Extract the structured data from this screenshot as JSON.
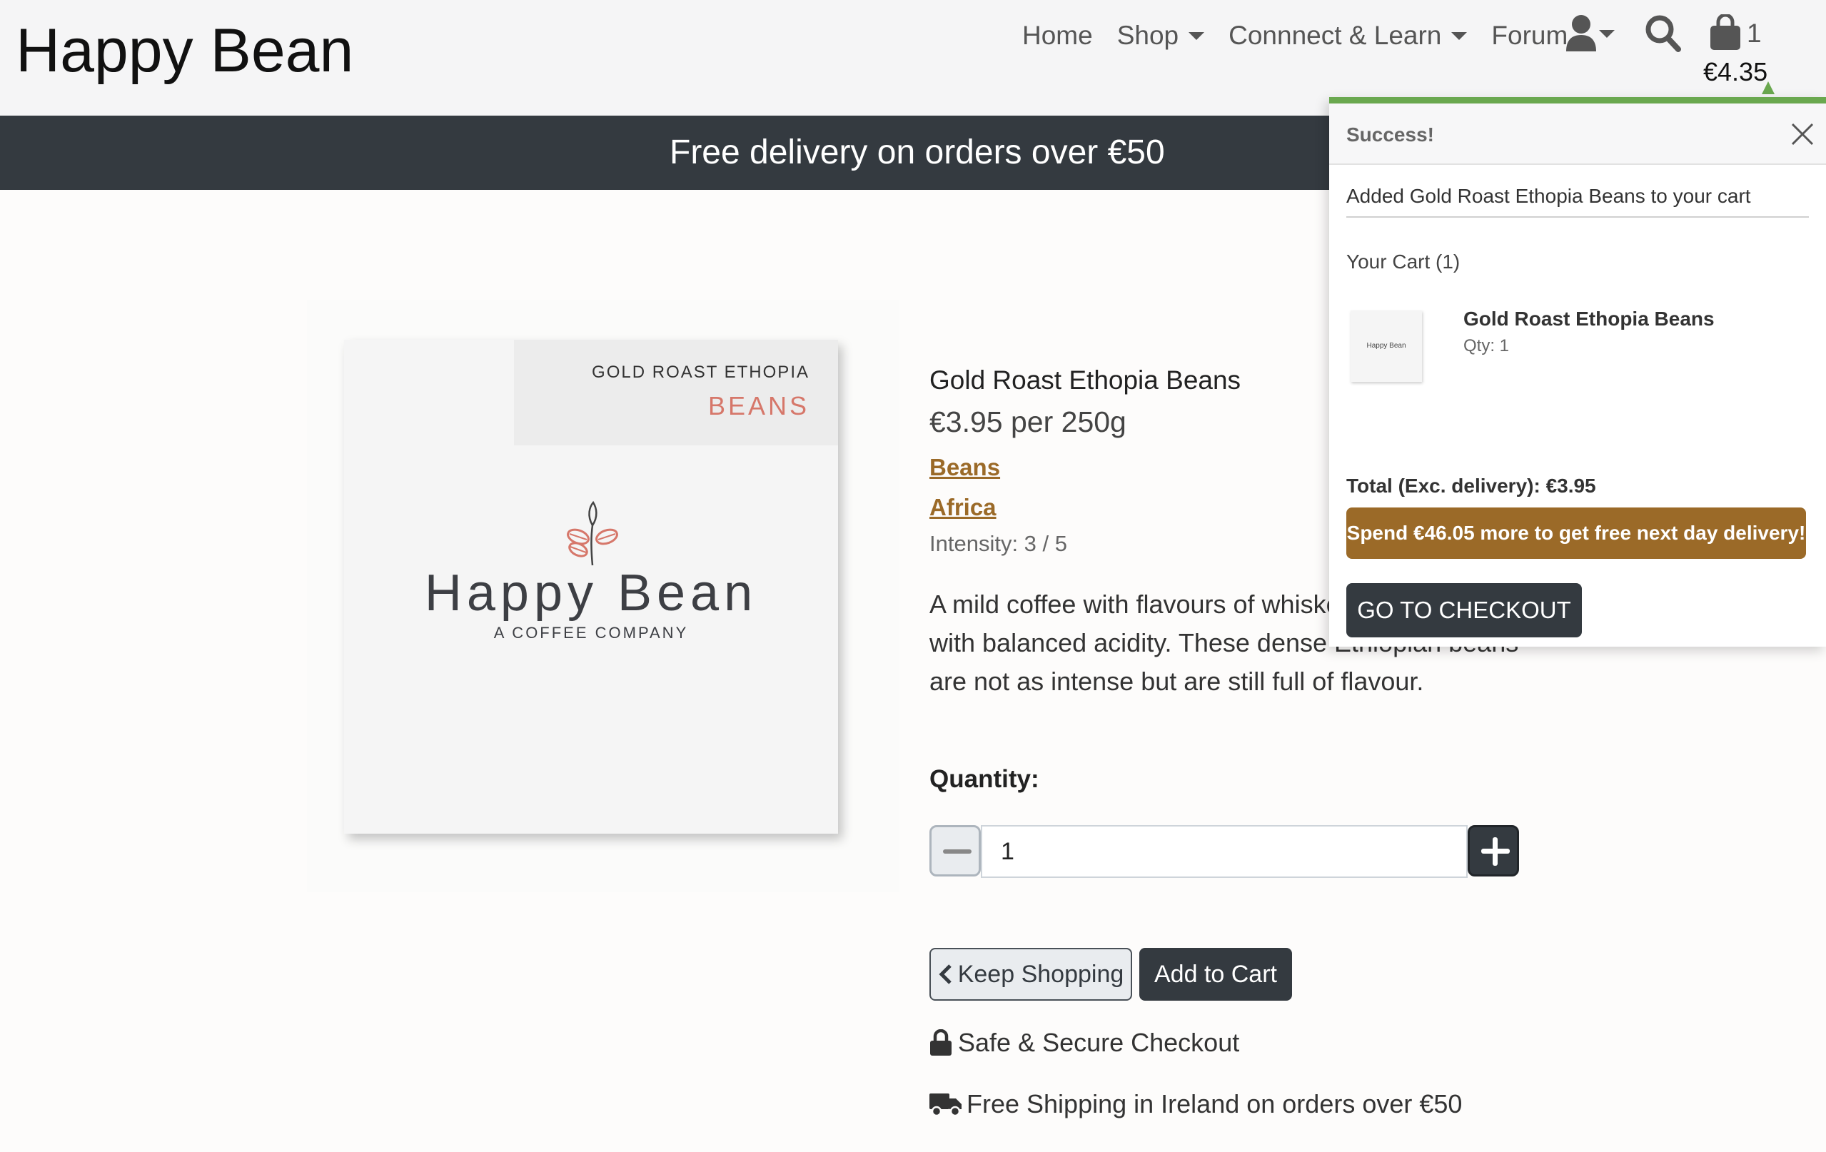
{
  "header": {
    "logo": "Happy Bean",
    "nav": {
      "home": "Home",
      "shop": "Shop",
      "connect": "Connnect & Learn",
      "forum": "Forum"
    },
    "cart_count": "1",
    "cart_total": "€4.35"
  },
  "banner": {
    "text": "Free delivery on orders over €50"
  },
  "product_image": {
    "tag_title": "GOLD ROAST ETHOPIA",
    "tag_sub": "BEANS",
    "brand": "Happy Bean",
    "company": "A COFFEE COMPANY"
  },
  "product": {
    "name": "Gold Roast Ethopia Beans",
    "price": "€3.95 per 250g",
    "category_link": "Beans",
    "region_link": "Africa",
    "intensity": "Intensity: 3 / 5",
    "description": "A mild coffee with flavours of whiskey and tropical fruit with balanced acidity. These dense Ethiopian beans are not as intense but are still full of flavour.",
    "quantity_label": "Quantity:",
    "quantity_value": "1",
    "keep_shopping": "Keep Shopping",
    "add_to_cart": "Add to Cart",
    "secure": "Safe & Secure Checkout",
    "shipping": "Free Shipping in Ireland on orders over €50"
  },
  "toast": {
    "title": "Success!",
    "message": "Added Gold Roast Ethopia Beans to your cart",
    "cart_heading": "Your Cart (1)",
    "item_name": "Gold Roast Ethopia Beans",
    "item_qty": "Qty: 1",
    "thumb_text": "Happy Bean",
    "total": "Total (Exc. delivery): €3.95",
    "promo": "Spend €46.05 more to get free next day delivery!",
    "checkout": "GO TO CHECKOUT"
  },
  "colors": {
    "dark": "#343a40",
    "accent_brown": "#9b6a28",
    "success_green": "#6aa84f",
    "beans_pink": "#d6776a"
  },
  "icons": [
    "user-icon",
    "search-icon",
    "shopping-bag-icon",
    "close-icon",
    "chevron-left-icon",
    "lock-icon",
    "truck-icon",
    "sprout-icon"
  ]
}
